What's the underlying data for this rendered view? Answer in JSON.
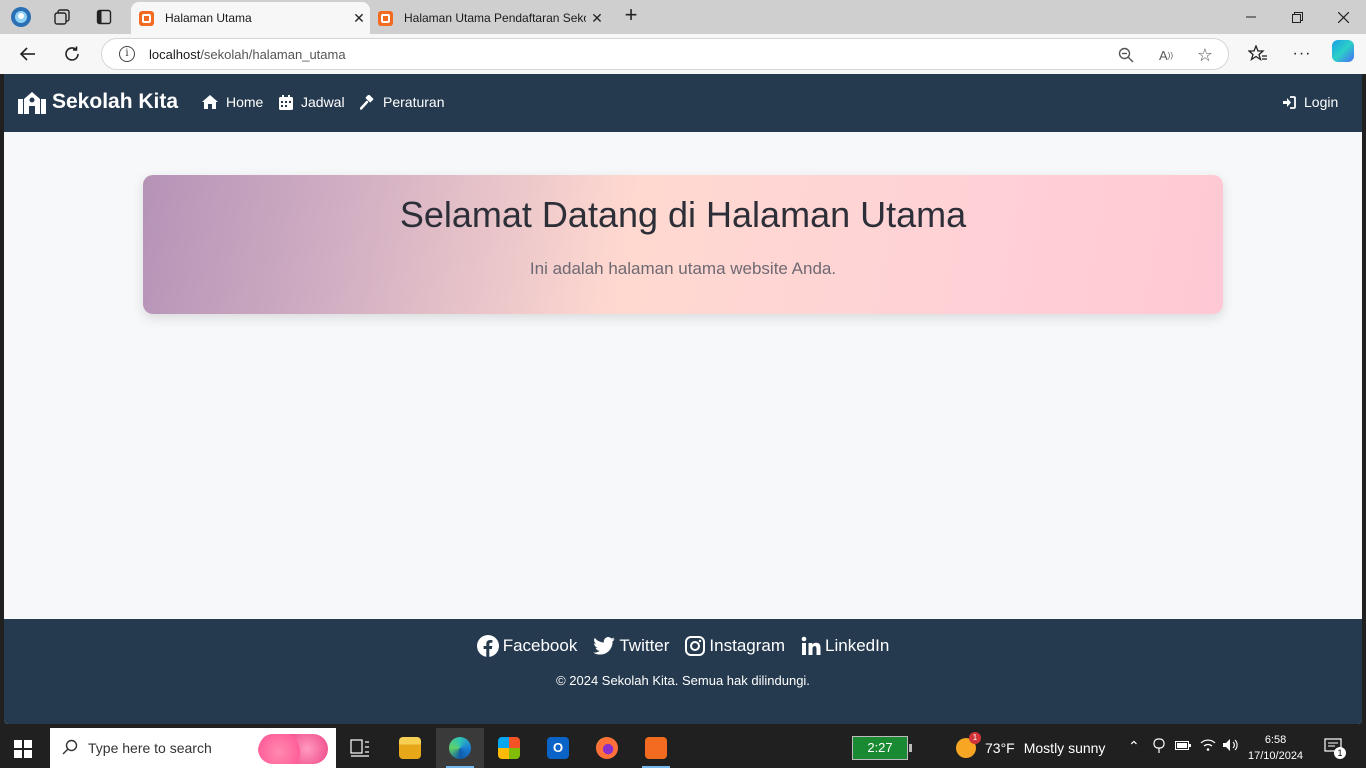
{
  "browser": {
    "tabs": [
      {
        "title": "Halaman Utama",
        "active": true
      },
      {
        "title": "Halaman Utama Pendaftaran Seko",
        "active": false
      }
    ],
    "new_tab": "+",
    "url_host": "localhost",
    "url_path": "/sekolah/halaman_utama"
  },
  "page": {
    "brand": "Sekolah Kita",
    "nav": [
      {
        "label": "Home",
        "icon": "home-icon"
      },
      {
        "label": "Jadwal",
        "icon": "calendar-icon"
      },
      {
        "label": "Peraturan",
        "icon": "gavel-icon"
      }
    ],
    "login": {
      "label": "Login",
      "icon": "sign-in-icon"
    },
    "hero": {
      "title": "Selamat Datang di Halaman Utama",
      "subtitle": "Ini adalah halaman utama website Anda."
    },
    "footer": {
      "social": [
        {
          "label": "Facebook",
          "icon": "facebook-icon"
        },
        {
          "label": "Twitter",
          "icon": "twitter-icon"
        },
        {
          "label": "Instagram",
          "icon": "instagram-icon"
        },
        {
          "label": "LinkedIn",
          "icon": "linkedin-icon"
        }
      ],
      "copyright": "© 2024 Sekolah Kita. Semua hak dilindungi."
    },
    "colors": {
      "navbar": "#253a4f",
      "background": "#f7f8fa",
      "hero_start": "#b593b8",
      "hero_end": "#ffc8d4"
    }
  },
  "taskbar": {
    "search_placeholder": "Type here to search",
    "battery": "2:27",
    "weather": {
      "temp": "73°F",
      "condition": "Mostly sunny",
      "badge": "1"
    },
    "clock": {
      "time": "6:58",
      "date": "17/10/2024"
    },
    "notifications": "1"
  }
}
